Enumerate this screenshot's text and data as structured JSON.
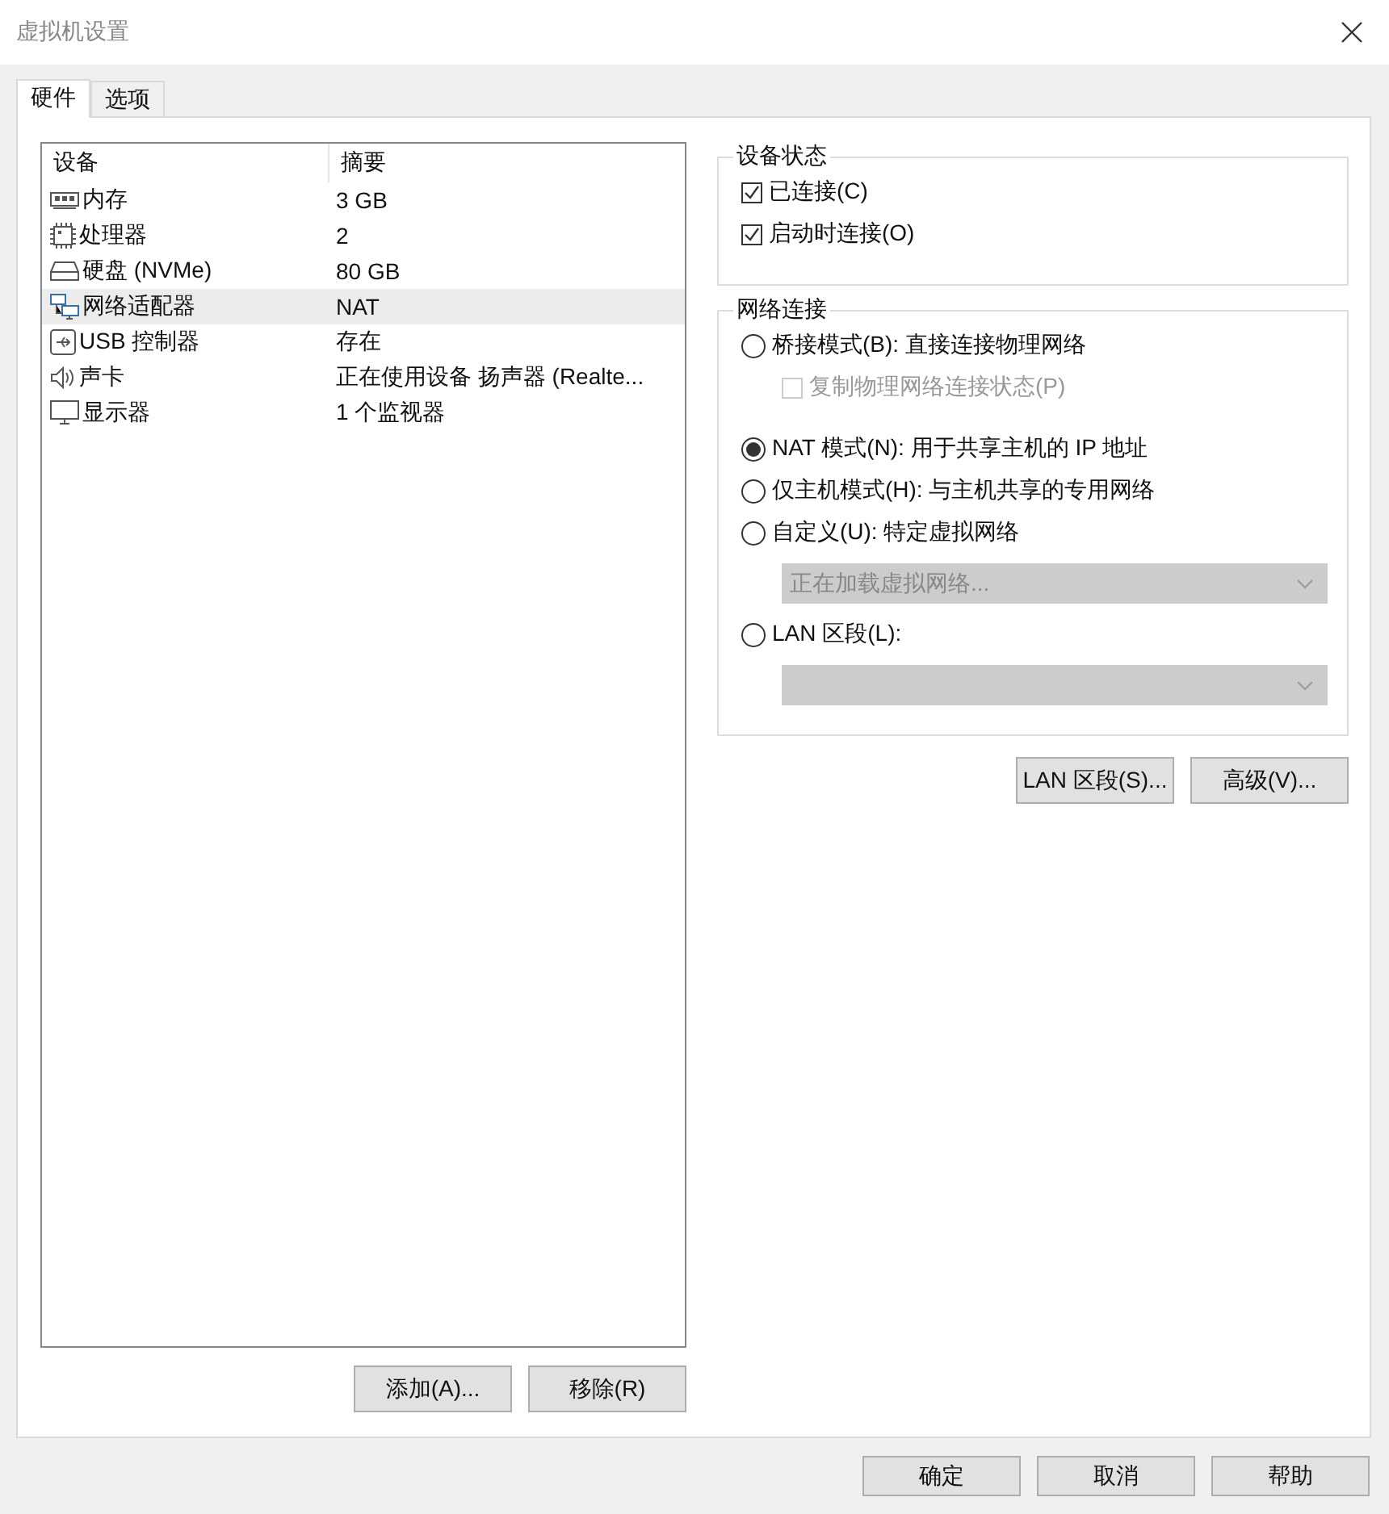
{
  "window": {
    "title": "虚拟机设置"
  },
  "tabs": [
    {
      "label": "硬件",
      "selected": true
    },
    {
      "label": "选项",
      "selected": false
    }
  ],
  "device_table": {
    "columns": [
      "设备",
      "摘要"
    ],
    "rows": [
      {
        "kind": "memory",
        "device": "内存",
        "summary": "3 GB",
        "selected": false
      },
      {
        "kind": "cpu",
        "device": "处理器",
        "summary": "2",
        "selected": false
      },
      {
        "kind": "disk",
        "device": "硬盘 (NVMe)",
        "summary": "80 GB",
        "selected": false
      },
      {
        "kind": "network",
        "device": "网络适配器",
        "summary": "NAT",
        "selected": true
      },
      {
        "kind": "usb",
        "device": "USB 控制器",
        "summary": "存在",
        "selected": false
      },
      {
        "kind": "sound",
        "device": "声卡",
        "summary": "正在使用设备 扬声器 (Realte...",
        "selected": false
      },
      {
        "kind": "monitor",
        "device": "显示器",
        "summary": "1 个监视器",
        "selected": false
      }
    ]
  },
  "device_buttons": [
    "添加(A)...",
    "移除(R)"
  ],
  "device_status": {
    "title": "设备状态",
    "options": [
      {
        "label": "已连接(C)",
        "checked": true
      },
      {
        "label": "启动时连接(O)",
        "checked": true
      }
    ]
  },
  "network_connection": {
    "title": "网络连接",
    "items": [
      {
        "kind": "radio",
        "label": "桥接模式(B): 直接连接物理网络",
        "selected": false
      },
      {
        "kind": "checkbox",
        "label": "复制物理网络连接状态(P)",
        "checked": false,
        "disabled": true
      },
      {
        "kind": "radio",
        "label": "NAT 模式(N): 用于共享主机的 IP 地址",
        "selected": true
      },
      {
        "kind": "radio",
        "label": "仅主机模式(H): 与主机共享的专用网络",
        "selected": false
      },
      {
        "kind": "radio",
        "label": "自定义(U): 特定虚拟网络",
        "selected": false
      },
      {
        "kind": "dropdown",
        "value": "正在加载虚拟网络...",
        "disabled": true
      },
      {
        "kind": "radio",
        "label": "LAN 区段(L):",
        "selected": false
      },
      {
        "kind": "dropdown",
        "disabled": true
      }
    ]
  },
  "network_buttons": [
    "LAN 区段(S)...",
    "高级(V)..."
  ],
  "dialog_buttons": [
    "确定",
    "取消",
    "帮助"
  ]
}
